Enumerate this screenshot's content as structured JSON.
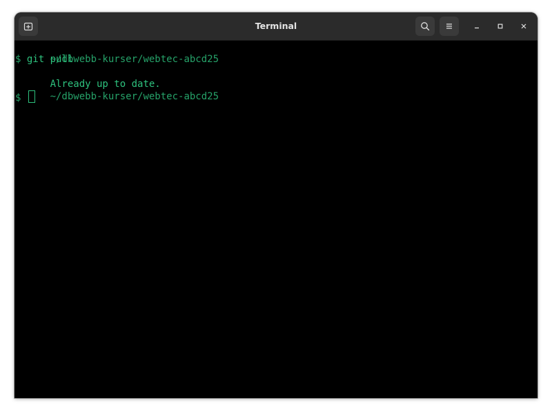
{
  "window": {
    "title": "Terminal"
  },
  "header": {
    "new_tab_icon": "new-tab-icon",
    "search_icon": "search-icon",
    "menu_icon": "hamburger-menu-icon",
    "minimize_icon": "minimize-icon",
    "maximize_icon": "maximize-icon",
    "close_icon": "close-icon"
  },
  "terminal": {
    "lines": [
      {
        "type": "path",
        "text": "~/dbwebb-kurser/webtec-abcd25"
      },
      {
        "type": "command",
        "prompt": "$ ",
        "text": "git pull"
      },
      {
        "type": "output",
        "text": "Already up to date."
      },
      {
        "type": "path",
        "text": "~/dbwebb-kurser/webtec-abcd25"
      },
      {
        "type": "prompt",
        "prompt": "$ "
      }
    ]
  },
  "colors": {
    "background": "#000000",
    "titlebar": "#2b2b2b",
    "text_green": "#2ec27e",
    "path_green": "#26a269"
  }
}
